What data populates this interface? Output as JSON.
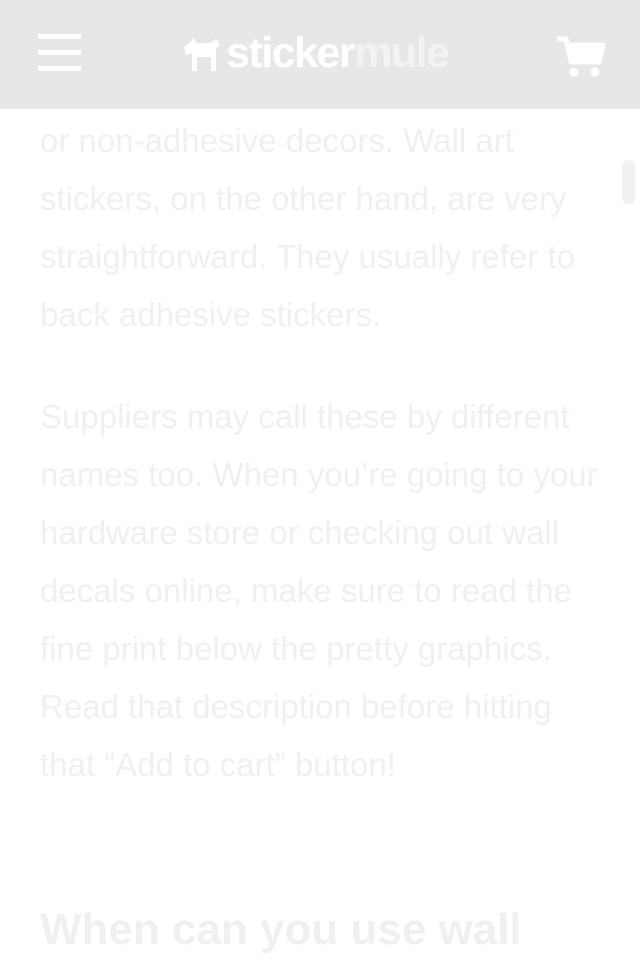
{
  "header": {
    "logo_part1": "sticker",
    "logo_part2": "mule",
    "menu_icon": "hamburger-menu-icon",
    "cart_icon": "shopping-cart-icon",
    "background": "#e7e7e7"
  },
  "article": {
    "paragraph1": "or non-adhesive decors. Wall art stickers, on the other hand, are very straightforward. They usually refer to back adhesive stickers.",
    "paragraph2": "Suppliers may call these by different names too. When you’re going to your hardware store or checking out wall decals online, make sure to read the fine print below the pretty graphics. Read that description before hitting that “Add to cart” button!",
    "heading": "When can you use wall"
  },
  "colors": {
    "text": "#f0f0f0",
    "header_icons": "#ffffff"
  }
}
